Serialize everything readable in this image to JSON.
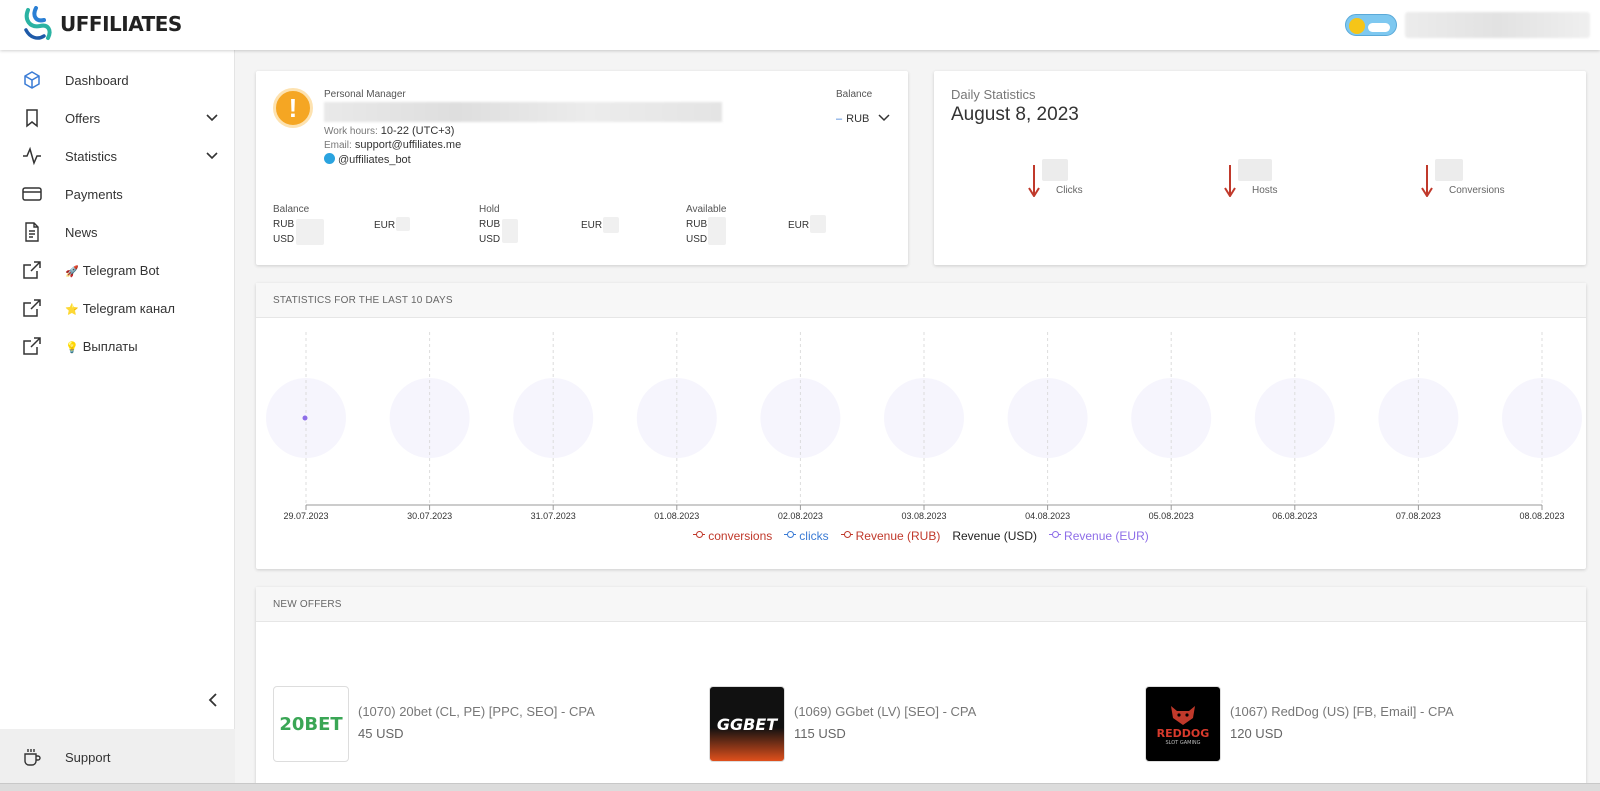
{
  "header": {
    "logo_text": "UFFILIATES"
  },
  "sidebar": {
    "items": [
      {
        "label": "Dashboard"
      },
      {
        "label": "Offers"
      },
      {
        "label": "Statistics"
      },
      {
        "label": "Payments"
      },
      {
        "label": "News"
      },
      {
        "label": "Telegram Bot",
        "emoji": "🚀"
      },
      {
        "label": "Telegram канал",
        "emoji": "⭐"
      },
      {
        "label": "Выплаты",
        "emoji": "💡"
      }
    ],
    "support_label": "Support"
  },
  "manager": {
    "title": "Personal Manager",
    "work_hours_key": "Work hours:",
    "work_hours": "10-22 (UTC+3)",
    "email_key": "Email:",
    "email": "support@uffiliates.me",
    "telegram": "@uffiliates_bot",
    "balance_label": "Balance",
    "currency": "RUB",
    "currency_prefix": "–",
    "groups": [
      {
        "title": "Balance",
        "c1": "RUB",
        "c2": "USD",
        "c3": "EUR"
      },
      {
        "title": "Hold",
        "c1": "RUB",
        "c2": "USD",
        "c3": "EUR"
      },
      {
        "title": "Available",
        "c1": "RUB",
        "c2": "USD",
        "c3": "EUR"
      }
    ]
  },
  "daily": {
    "title": "Daily Statistics",
    "date": "August 8, 2023",
    "metrics": [
      {
        "label": "Clicks"
      },
      {
        "label": "Hosts"
      },
      {
        "label": "Conversions"
      }
    ]
  },
  "stats": {
    "section_title": "STATISTICS FOR THE LAST 10 DAYS",
    "dates": [
      "29.07.2023",
      "30.07.2023",
      "31.07.2023",
      "01.08.2023",
      "02.08.2023",
      "03.08.2023",
      "04.08.2023",
      "05.08.2023",
      "06.08.2023",
      "07.08.2023",
      "08.08.2023"
    ],
    "legend": [
      {
        "label": "conversions",
        "color": "#c0392b"
      },
      {
        "label": "clicks",
        "color": "#3a7bd5"
      },
      {
        "label": "Revenue (RUB)",
        "color": "#c0392b"
      },
      {
        "label": "Revenue (USD)",
        "color": "#222222"
      },
      {
        "label": "Revenue (EUR)",
        "color": "#8e6ee8"
      }
    ]
  },
  "offers": {
    "section_title": "NEW OFFERS",
    "items": [
      {
        "name": "(1070) 20bet (CL, PE) [PPC, SEO] - CPA",
        "price": "45 USD",
        "logo_text": "20BET"
      },
      {
        "name": "(1069) GGbet (LV) [SEO] - CPA",
        "price": "115 USD",
        "logo_text": "GGBET"
      },
      {
        "name": "(1067) RedDog (US) [FB, Email] - CPA",
        "price": "120 USD",
        "logo_text": "REDDOG",
        "logo_sub": "SLOT GAMING"
      }
    ]
  },
  "colors": {
    "accent": "#3a7bd5",
    "warning": "#f5a623",
    "arrow_down": "#c0392b",
    "eur_line": "#8e6ee8"
  }
}
